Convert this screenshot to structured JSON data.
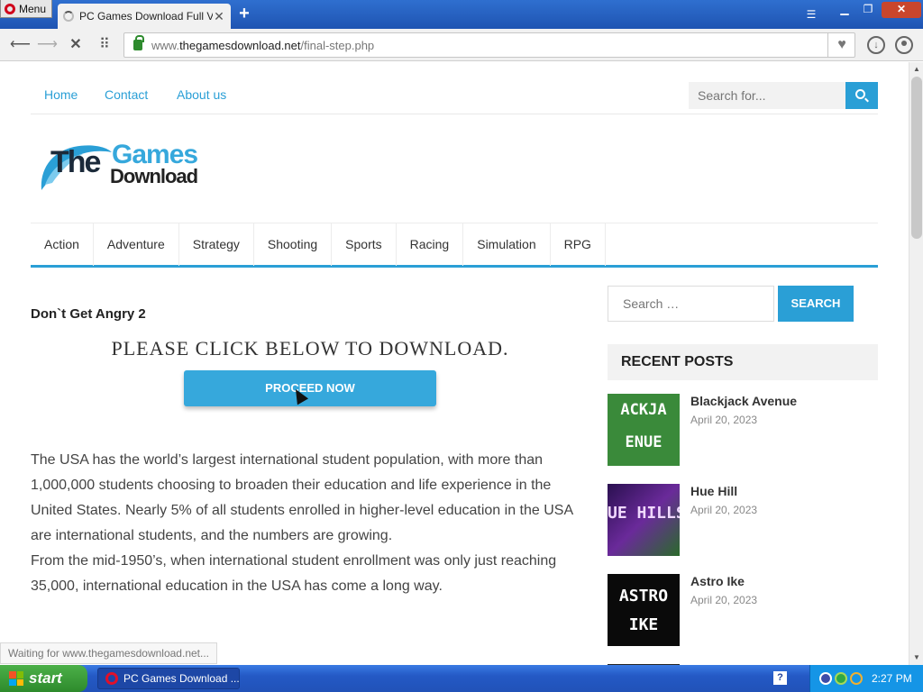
{
  "browser": {
    "menu_label": "Menu",
    "tab_title": "PC Games Download Full Version",
    "tab_close": "✕",
    "new_tab": "+",
    "url_prefix": "www.",
    "url_domain": "thegamesdownload.net",
    "url_path": "/final-step.php",
    "status_text": "Waiting for www.thegamesdownload.net..."
  },
  "site": {
    "top_menu": [
      "Home",
      "Contact",
      "About us"
    ],
    "top_search_placeholder": "Search for...",
    "logo": {
      "the": "The",
      "games": "Games",
      "download": "Download"
    },
    "categories": [
      "Action",
      "Adventure",
      "Strategy",
      "Shooting",
      "Sports",
      "Racing",
      "Simulation",
      "RPG"
    ],
    "accent_color": "#2a9fd6"
  },
  "main": {
    "post_title": "Don`t Get Angry 2",
    "download_heading": "PLEASE CLICK BELOW TO DOWNLOAD.",
    "proceed_label": "PROCEED NOW",
    "paragraphs": [
      "The USA has the world’s largest international student population, with more than 1,000,000 students choosing to broaden their education and life experience in the United States. Nearly 5% of all students enrolled in higher-level education in the USA are international students, and the numbers are growing.",
      "From the mid-1950’s, when international student enrollment was only just reaching 35,000, international education in the USA has come a long way."
    ]
  },
  "sidebar": {
    "search_placeholder": "Search …",
    "search_button": "SEARCH",
    "recent_heading": "RECENT POSTS",
    "posts": [
      {
        "title": "Blackjack Avenue",
        "date": "April 20, 2023",
        "thumb_line1": "ACKJA",
        "thumb_line2": "ENUE"
      },
      {
        "title": "Hue Hill",
        "date": "April 20, 2023",
        "thumb_line1": "UE HILLS"
      },
      {
        "title": "Astro Ike",
        "date": "April 20, 2023",
        "thumb_line1": "ASTRO",
        "thumb_line2": "IKE"
      }
    ]
  },
  "taskbar": {
    "start_label": "start",
    "task_label": "PC Games Download ...",
    "clock": "2:27 PM"
  }
}
